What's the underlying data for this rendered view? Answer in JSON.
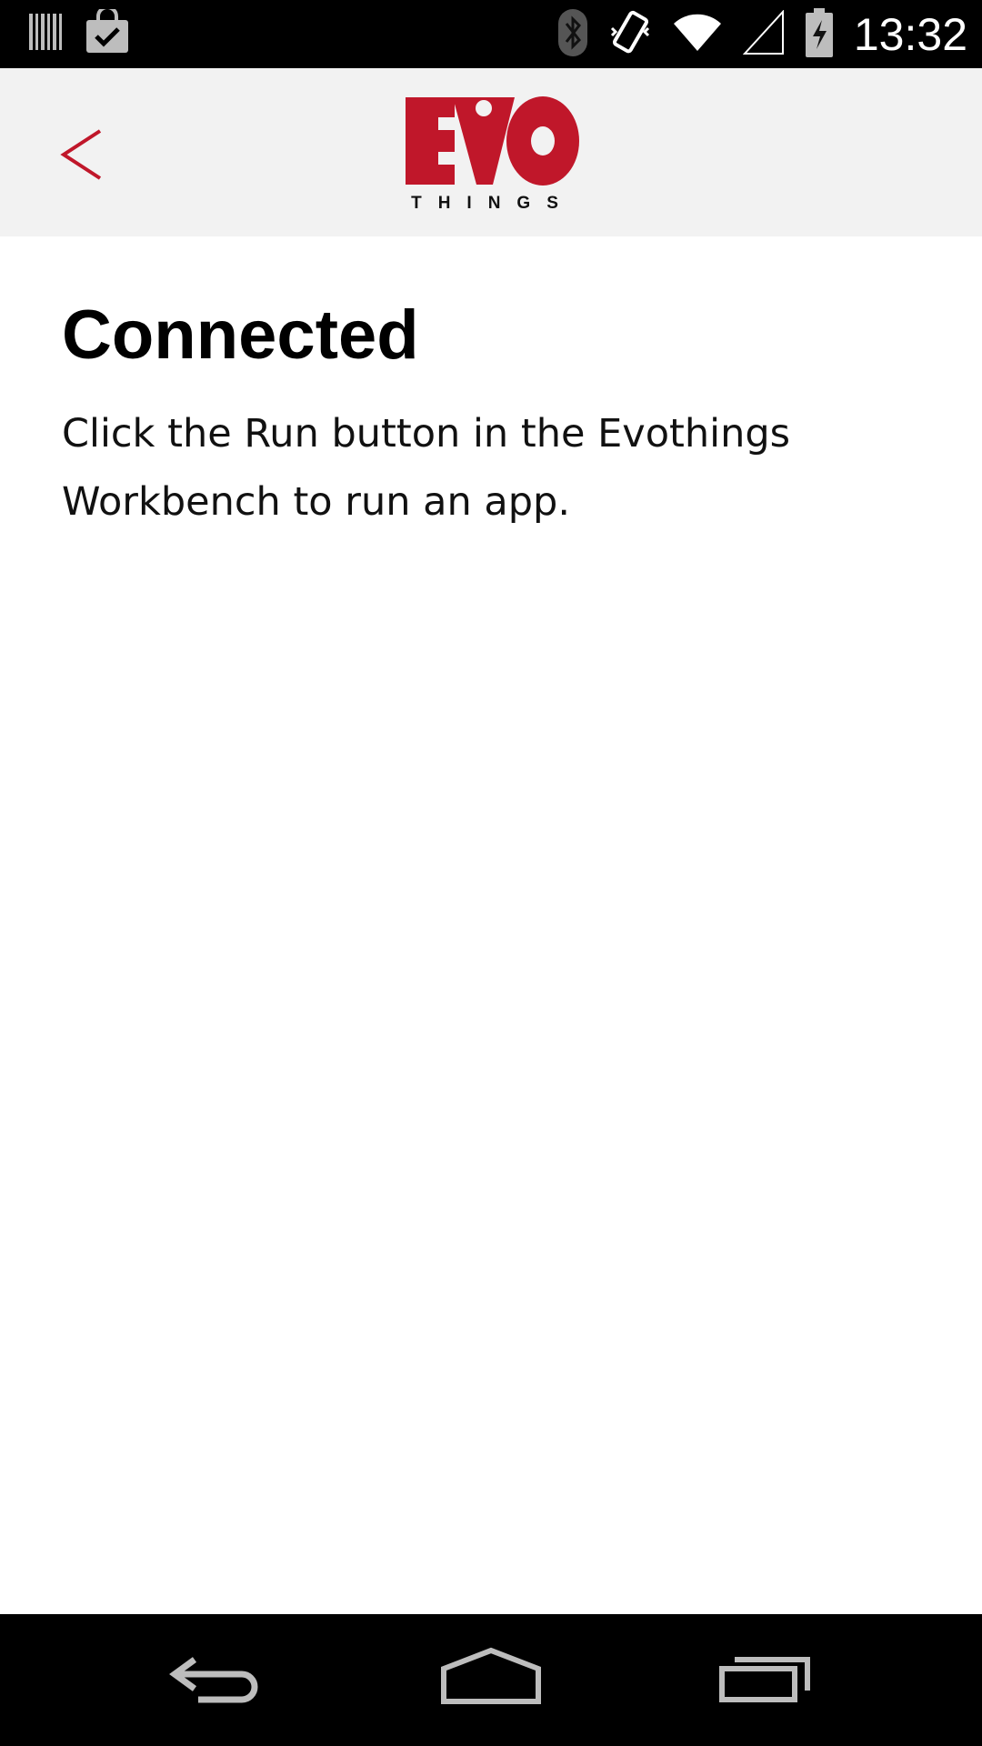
{
  "status_bar": {
    "time": "13:32",
    "left_icons": [
      "barcode-icon",
      "shopping-bag-check-icon"
    ],
    "right_icons": [
      "bluetooth-icon",
      "vibrate-icon",
      "wifi-icon",
      "signal-icon",
      "battery-charging-icon"
    ]
  },
  "header": {
    "back_label": "<",
    "logo_main": "EVO",
    "logo_sub": "THINGS",
    "brand_color": "#c0172a",
    "background": "#f2f2f2"
  },
  "main": {
    "title": "Connected",
    "message": "Click the Run button in the Evothings Workbench to run an app."
  },
  "nav_bar": {
    "buttons": [
      "back-nav-icon",
      "home-nav-icon",
      "recents-nav-icon"
    ]
  }
}
